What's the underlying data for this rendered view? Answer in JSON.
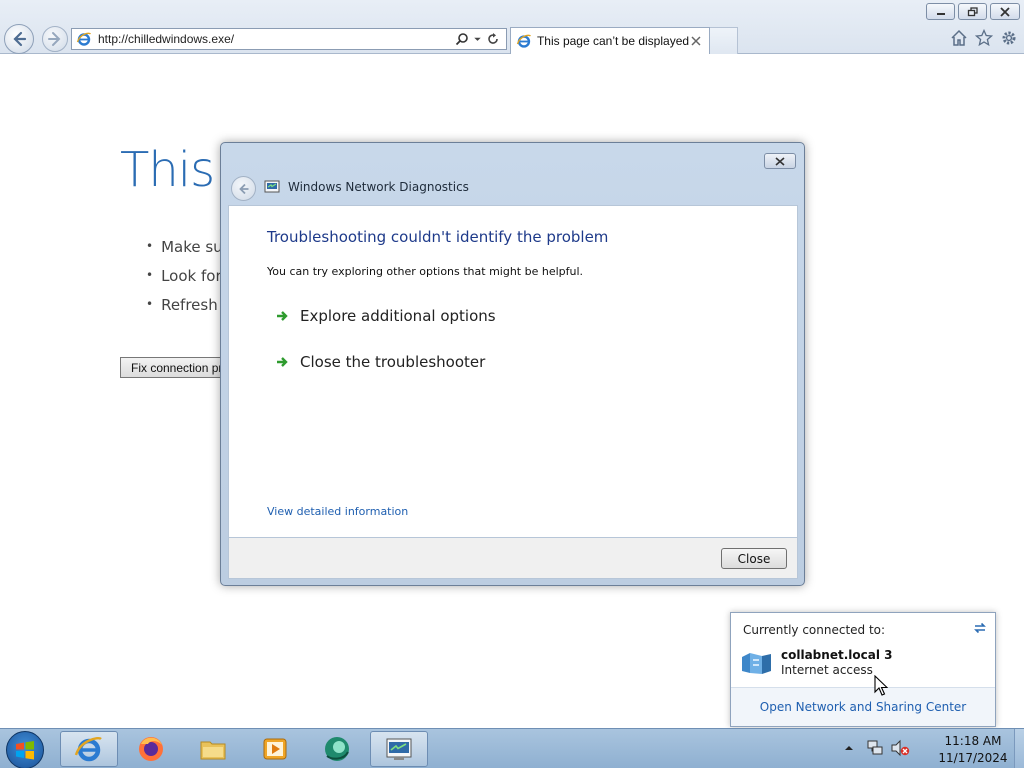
{
  "browser": {
    "address_url": "http://chilledwindows.exe/",
    "tab_title": "This page can’t be displayed"
  },
  "page": {
    "heading": "This",
    "bullets": [
      "Make sur",
      "Look for",
      "Refresh t"
    ],
    "fix_button_label": "Fix connection pr"
  },
  "dialog": {
    "title": "Windows Network Diagnostics",
    "heading": "Troubleshooting couldn't identify the problem",
    "subtext": "You can try exploring other options that might be helpful.",
    "options": [
      "Explore additional options",
      "Close the troubleshooter"
    ],
    "details_link": "View detailed information",
    "close_button": "Close"
  },
  "network_flyout": {
    "header": "Currently connected to:",
    "network_name": "collabnet.local  3",
    "network_status": "Internet access",
    "footer_link": "Open Network and Sharing Center"
  },
  "taskbar": {
    "clock_time": "11:18 AM",
    "clock_date": "11/17/2024",
    "items": [
      "internet-explorer-icon",
      "firefox-icon",
      "file-explorer-icon",
      "media-player-icon",
      "app-icon",
      "network-diagnostics-icon"
    ]
  },
  "colors": {
    "link_blue": "#1f5fb0",
    "heading_blue": "#2b6cb3",
    "arrow_green": "#2e9b2e",
    "taskbar_blue": "#9bb9d8"
  }
}
